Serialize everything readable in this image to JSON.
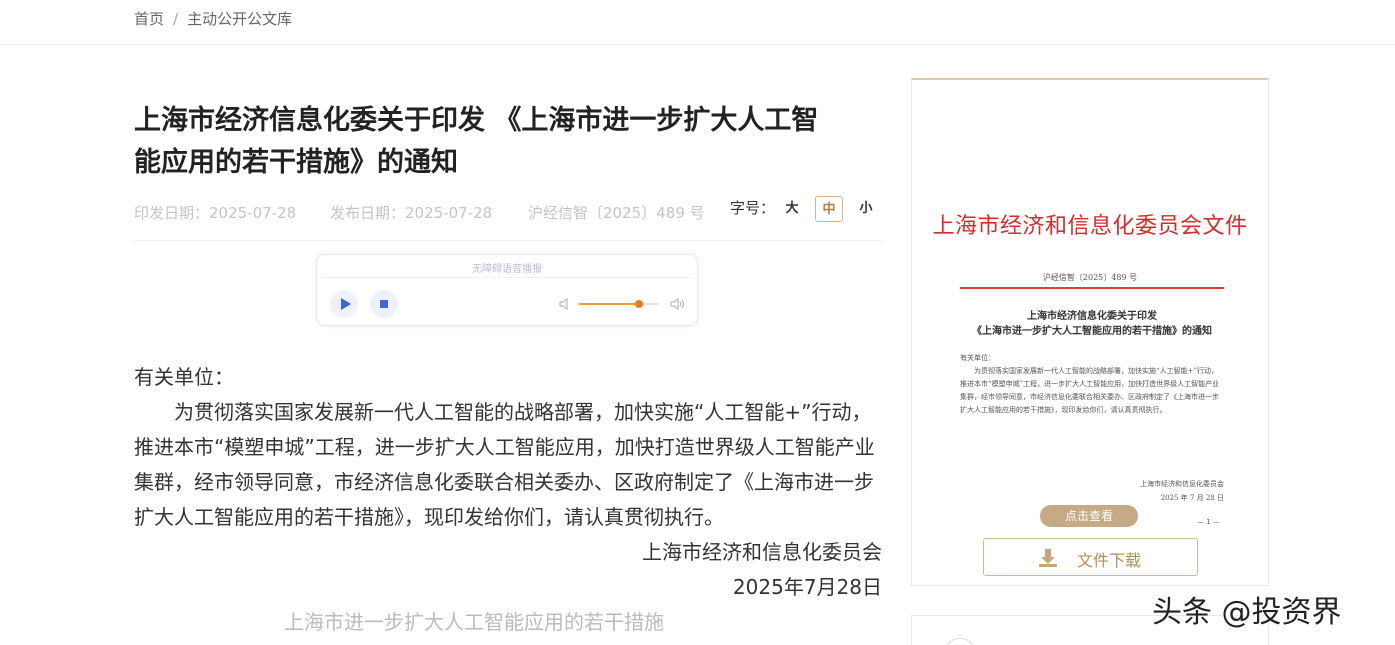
{
  "breadcrumb": {
    "home": "首页",
    "separator": "/",
    "current": "主动公开公文库"
  },
  "article": {
    "title": "上海市经济信息化委关于印发 《上海市进一步扩大人工智能应用的若干措施》的通知",
    "meta": {
      "issue_date": "印发日期：2025-07-28",
      "publish_date": "发布日期：2025-07-28",
      "doc_number": "沪经信智〔2025〕489 号",
      "font_size_label": "字号：",
      "font_sizes": [
        "大",
        "中",
        "小"
      ],
      "font_size_selected": "中"
    },
    "player": {
      "title": "无障碍语音播报",
      "volume_level": 0.75
    },
    "body": {
      "salutation": "有关单位：",
      "paragraph": "为贯彻落实国家发展新一代人工智能的战略部署，加快实施“人工智能+”行动，推进本市“模塑申城”工程，进一步扩大人工智能应用，加快打造世界级人工智能产业集群，经市领导同意，市经济信息化委联合相关委办、区政府制定了《上海市进一步扩大人工智能应用的若干措施》，现印发给你们，请认真贯彻执行。",
      "signature": "上海市经济和信息化委员会",
      "date": "2025年7月28日",
      "next_line": "上海市进一步扩大人工智能应用的若干措施"
    }
  },
  "document_preview": {
    "header": "上海市经济和信息化委员会文件",
    "number": "沪经信智〔2025〕489 号",
    "title_line1": "上海市经济信息化委关于印发",
    "title_line2": "《上海市进一步扩大人工智能应用的若干措施》的通知",
    "salutation": "有关单位：",
    "body": "为贯彻落实国家发展新一代人工智能的战略部署，加快实施“人工智能+”行动，推进本市“模塑申城”工程，进一步扩大人工智能应用，加快打造世界级人工智能产业集群，经市领导同意，市经济信息化委联合相关委办、区政府制定了《上海市进一步扩大人工智能应用的若干措施》，现印发给你们，请认真贯彻执行。",
    "sign_org": "上海市经济和信息化委员会",
    "sign_date": "2025 年 7 月 28 日",
    "page_mark": "— 1 —",
    "view_label": "点击查看",
    "download_label": "文件下载"
  },
  "watermark": "头条 @投资界",
  "colors": {
    "accent_gold": "#c5aa86",
    "doc_red": "#d92b2b",
    "player_blue": "#3a66e0",
    "volume_orange": "#f07a1e"
  }
}
